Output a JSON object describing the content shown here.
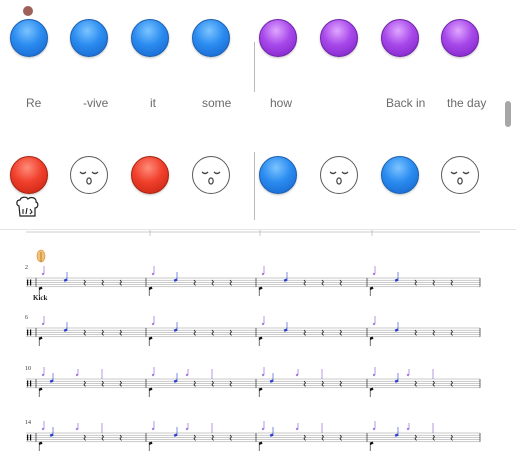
{
  "pads_row1": [
    {
      "color": "blue"
    },
    {
      "color": "blue"
    },
    {
      "color": "blue"
    },
    {
      "color": "blue"
    },
    {
      "color": "purple"
    },
    {
      "color": "purple"
    },
    {
      "color": "purple"
    },
    {
      "color": "purple"
    }
  ],
  "lyrics": [
    "Re",
    "-vive",
    "it",
    "some",
    "how",
    "",
    "Back in",
    "the day"
  ],
  "pads_row2": [
    {
      "type": "red"
    },
    {
      "type": "face"
    },
    {
      "type": "red"
    },
    {
      "type": "face"
    },
    {
      "type": "blue"
    },
    {
      "type": "face"
    },
    {
      "type": "blue"
    },
    {
      "type": "face"
    }
  ],
  "score": {
    "systems": [
      {
        "measure_number": "2",
        "instrument_label": "Kick"
      },
      {
        "measure_number": "6",
        "instrument_label": ""
      },
      {
        "measure_number": "10",
        "instrument_label": ""
      },
      {
        "measure_number": "14",
        "instrument_label": ""
      }
    ]
  },
  "colors": {
    "blue": "#2b8cf0",
    "purple": "#a748ea",
    "red": "#f0402c",
    "note_blue": "#2a3fd0",
    "note_purple": "#8a4fd6"
  }
}
